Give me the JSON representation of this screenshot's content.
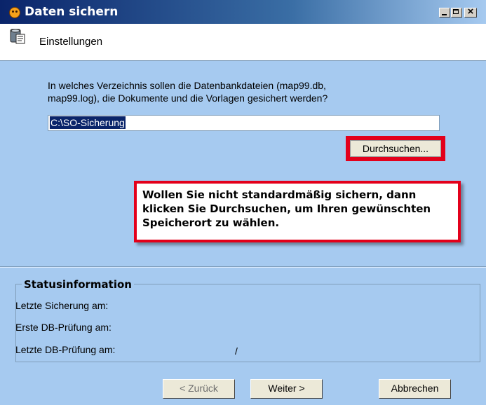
{
  "window": {
    "title": "Daten sichern"
  },
  "header": {
    "label": "Einstellungen"
  },
  "prompt": {
    "line1": "In welches Verzeichnis sollen die Datenbankdateien (map99.db,",
    "line2": "map99.log), die Dokumente und die Vorlagen gesichert werden?"
  },
  "path": {
    "value": "C:\\SO-Sicherung"
  },
  "browse": {
    "label": "Durchsuchen..."
  },
  "tip": {
    "text": "Wollen Sie nicht standardmäßig sichern, dann klicken Sie Durchsuchen, um Ihren gewünschten Speicherort zu wählen."
  },
  "status": {
    "legend": "Statusinformation",
    "last_backup_label": "Letzte Sicherung am:",
    "first_check_label": "Erste DB-Prüfung am:",
    "last_check_label": "Letzte DB-Prüfung am:",
    "last_check_value": "/"
  },
  "buttons": {
    "back": "< Zurück",
    "next": "Weiter >",
    "cancel": "Abbrechen"
  }
}
